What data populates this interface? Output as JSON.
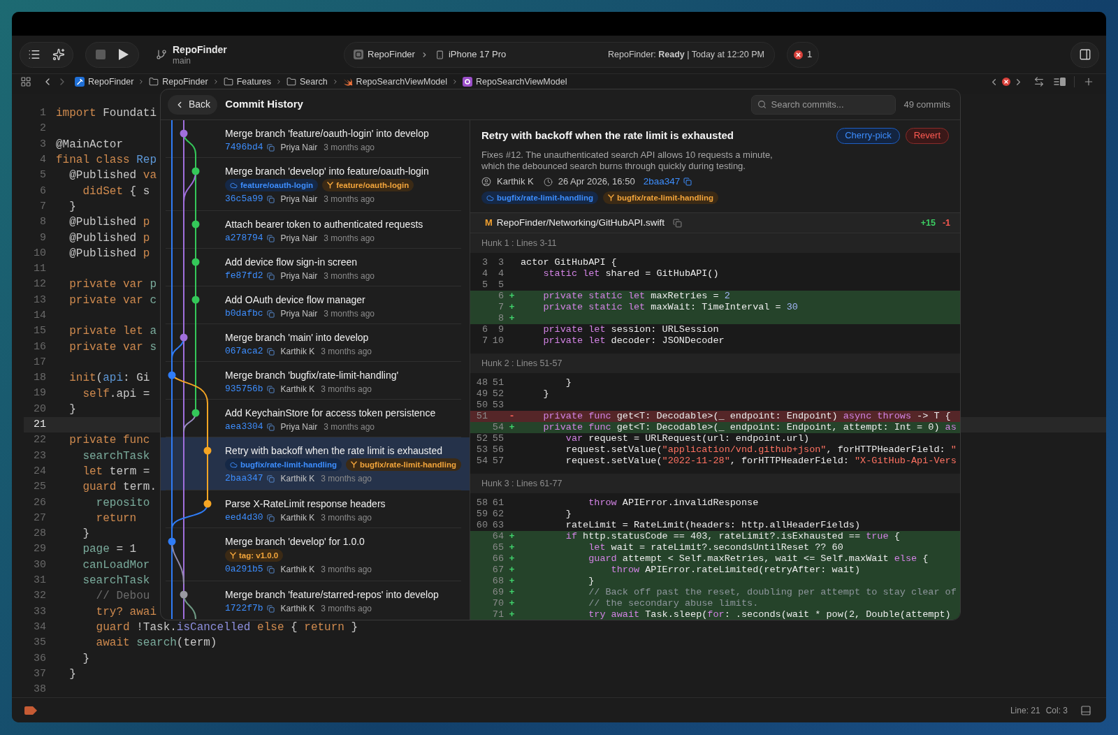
{
  "toolbar": {
    "project": "RepoFinder",
    "branch": "main",
    "scheme": "RepoFinder",
    "device": "iPhone 17 Pro",
    "status": "RepoFinder: **Ready** | Today at 12:20 PM",
    "issues": "1"
  },
  "breadcrumbs": [
    {
      "kind": "project",
      "label": "RepoFinder"
    },
    {
      "kind": "folder",
      "label": "RepoFinder"
    },
    {
      "kind": "folder",
      "label": "Features"
    },
    {
      "kind": "folder",
      "label": "Search"
    },
    {
      "kind": "swift",
      "label": "RepoSearchViewModel"
    },
    {
      "kind": "class",
      "label": "RepoSearchViewModel"
    }
  ],
  "editor": {
    "lines": [
      {
        "number": "1",
        "current": false,
        "tokens": [
          {
            "kind": "keyword",
            "text": "import"
          },
          {
            "kind": "plain",
            "text": " Foundati"
          }
        ]
      },
      {
        "number": "2",
        "current": false
      },
      {
        "number": "3",
        "current": false,
        "tokens": [
          {
            "kind": "plain",
            "text": "@MainActor"
          }
        ]
      },
      {
        "number": "4",
        "current": false,
        "tokens": [
          {
            "kind": "keyword",
            "text": "final class"
          },
          {
            "kind": "type",
            "text": " Rep"
          }
        ]
      },
      {
        "number": "5",
        "current": false,
        "tokens": [
          {
            "kind": "plain",
            "text": "  @Published"
          },
          {
            "kind": "keyword",
            "text": " va"
          }
        ]
      },
      {
        "number": "6",
        "current": false,
        "tokens": [
          {
            "kind": "keyword",
            "text": "    didSet"
          },
          {
            "kind": "plain",
            "text": " { s"
          }
        ]
      },
      {
        "number": "7",
        "current": false,
        "tokens": [
          {
            "kind": "plain",
            "text": "  }"
          }
        ]
      },
      {
        "number": "8",
        "current": false,
        "tokens": [
          {
            "kind": "plain",
            "text": "  @Published"
          },
          {
            "kind": "keyword",
            "text": " p"
          }
        ]
      },
      {
        "number": "9",
        "current": false,
        "tokens": [
          {
            "kind": "plain",
            "text": "  @Published"
          },
          {
            "kind": "keyword",
            "text": " p"
          }
        ]
      },
      {
        "number": "10",
        "current": false,
        "tokens": [
          {
            "kind": "plain",
            "text": "  @Published"
          },
          {
            "kind": "keyword",
            "text": " p"
          }
        ]
      },
      {
        "number": "11",
        "current": false
      },
      {
        "number": "12",
        "current": false,
        "tokens": [
          {
            "kind": "keyword",
            "text": "  private var"
          },
          {
            "kind": "identifier",
            "text": " p"
          }
        ]
      },
      {
        "number": "13",
        "current": false,
        "tokens": [
          {
            "kind": "keyword",
            "text": "  private var"
          },
          {
            "kind": "identifier",
            "text": " c"
          }
        ]
      },
      {
        "number": "14",
        "current": false
      },
      {
        "number": "15",
        "current": false,
        "tokens": [
          {
            "kind": "keyword",
            "text": "  private let"
          },
          {
            "kind": "identifier",
            "text": " a"
          }
        ]
      },
      {
        "number": "16",
        "current": false,
        "tokens": [
          {
            "kind": "keyword",
            "text": "  private var"
          },
          {
            "kind": "identifier",
            "text": " s"
          }
        ]
      },
      {
        "number": "17",
        "current": false
      },
      {
        "number": "18",
        "current": false,
        "tokens": [
          {
            "kind": "keyword",
            "text": "  init"
          },
          {
            "kind": "plain",
            "text": "("
          },
          {
            "kind": "type",
            "text": "api"
          },
          {
            "kind": "plain",
            "text": ": Gi"
          }
        ]
      },
      {
        "number": "19",
        "current": false,
        "tokens": [
          {
            "kind": "keyword",
            "text": "    self"
          },
          {
            "kind": "plain",
            "text": ".api ="
          }
        ]
      },
      {
        "number": "20",
        "current": false,
        "tokens": [
          {
            "kind": "plain",
            "text": "  }"
          }
        ]
      },
      {
        "number": "21",
        "current": true
      },
      {
        "number": "22",
        "current": false,
        "tokens": [
          {
            "kind": "keyword",
            "text": "  private func"
          }
        ]
      },
      {
        "number": "23",
        "current": false,
        "tokens": [
          {
            "kind": "identifier",
            "text": "    searchTask"
          }
        ]
      },
      {
        "number": "24",
        "current": false,
        "tokens": [
          {
            "kind": "keyword",
            "text": "    let"
          },
          {
            "kind": "plain",
            "text": " term ="
          }
        ]
      },
      {
        "number": "25",
        "current": false,
        "tokens": [
          {
            "kind": "keyword",
            "text": "    guard"
          },
          {
            "kind": "plain",
            "text": " term."
          }
        ]
      },
      {
        "number": "26",
        "current": false,
        "tokens": [
          {
            "kind": "identifier",
            "text": "      reposito"
          }
        ]
      },
      {
        "number": "27",
        "current": false,
        "tokens": [
          {
            "kind": "keyword",
            "text": "      return"
          }
        ]
      },
      {
        "number": "28",
        "current": false,
        "tokens": [
          {
            "kind": "plain",
            "text": "    }"
          }
        ]
      },
      {
        "number": "29",
        "current": false,
        "tokens": [
          {
            "kind": "identifier",
            "text": "    page"
          },
          {
            "kind": "plain",
            "text": " = 1"
          }
        ]
      },
      {
        "number": "30",
        "current": false,
        "tokens": [
          {
            "kind": "identifier",
            "text": "    canLoadMor"
          }
        ]
      },
      {
        "number": "31",
        "current": false,
        "tokens": [
          {
            "kind": "identifier",
            "text": "    searchTask"
          }
        ]
      },
      {
        "number": "32",
        "current": false,
        "tokens": [
          {
            "kind": "comment",
            "text": "      // Debou"
          }
        ]
      },
      {
        "number": "33",
        "current": false,
        "tokens": [
          {
            "kind": "keyword",
            "text": "      try? awai"
          }
        ]
      },
      {
        "number": "34",
        "current": false,
        "tokens": [
          {
            "kind": "keyword",
            "text": "      guard"
          },
          {
            "kind": "plain",
            "text": " !Task."
          },
          {
            "kind": "method",
            "text": "isCancelled"
          },
          {
            "kind": "keyword",
            "text": " else"
          },
          {
            "kind": "plain",
            "text": " {"
          },
          {
            "kind": "keyword",
            "text": " return"
          },
          {
            "kind": "plain",
            "text": " }"
          }
        ]
      },
      {
        "number": "35",
        "current": false,
        "tokens": [
          {
            "kind": "keyword",
            "text": "      await"
          },
          {
            "kind": "identifier",
            "text": " search"
          },
          {
            "kind": "plain",
            "text": "(term)"
          }
        ]
      },
      {
        "number": "36",
        "current": false,
        "tokens": [
          {
            "kind": "plain",
            "text": "    }"
          }
        ]
      },
      {
        "number": "37",
        "current": false,
        "tokens": [
          {
            "kind": "plain",
            "text": "  }"
          }
        ]
      },
      {
        "number": "38",
        "current": false
      }
    ]
  },
  "commit_history": {
    "back": "Back",
    "title": "Commit History",
    "search": {
      "placeholder": "Search commits..."
    },
    "count": "49 commits",
    "commits": [
      {
        "title": "Merge branch 'feature/oauth-login' into develop",
        "hash": "7496bd4",
        "author": "Priya Nair",
        "time": "3 months ago",
        "color": "#a06fdc",
        "selected": false
      },
      {
        "title": "Merge branch 'develop' into feature/oauth-login",
        "hash": "36c5a99",
        "author": "Priya Nair",
        "time": "3 months ago",
        "color": "#34c759",
        "selected": false,
        "refs": [
          {
            "kind": "remote",
            "label": "feature/oauth-login"
          },
          {
            "kind": "branch",
            "label": "feature/oauth-login"
          }
        ]
      },
      {
        "title": "Attach bearer token to authenticated requests",
        "hash": "a278794",
        "author": "Priya Nair",
        "time": "3 months ago",
        "color": "#34c759",
        "selected": false
      },
      {
        "title": "Add device flow sign-in screen",
        "hash": "fe87fd2",
        "author": "Priya Nair",
        "time": "3 months ago",
        "color": "#34c759",
        "selected": false
      },
      {
        "title": "Add OAuth device flow manager",
        "hash": "b0dafbc",
        "author": "Priya Nair",
        "time": "3 months ago",
        "color": "#34c759",
        "selected": false
      },
      {
        "title": "Merge branch 'main' into develop",
        "hash": "067aca2",
        "author": "Karthik K",
        "time": "3 months ago",
        "color": "#a06fdc",
        "selected": false
      },
      {
        "title": "Merge branch 'bugfix/rate-limit-handling'",
        "hash": "935756b",
        "author": "Karthik K",
        "time": "3 months ago",
        "color": "#2f7cf6",
        "selected": false
      },
      {
        "title": "Add KeychainStore for access token persistence",
        "hash": "aea3304",
        "author": "Priya Nair",
        "time": "3 months ago",
        "color": "#34c759",
        "selected": false
      },
      {
        "title": "Retry with backoff when the rate limit is exhausted",
        "hash": "2baa347",
        "author": "Karthik K",
        "time": "3 months ago",
        "color": "#f5a524",
        "selected": true,
        "refs": [
          {
            "kind": "remote",
            "label": "bugfix/rate-limit-handling"
          },
          {
            "kind": "branch",
            "label": "bugfix/rate-limit-handling"
          }
        ]
      },
      {
        "title": "Parse X-RateLimit response headers",
        "hash": "eed4d30",
        "author": "Karthik K",
        "time": "3 months ago",
        "color": "#f5a524",
        "selected": false
      },
      {
        "title": "Merge branch 'develop' for 1.0.0",
        "hash": "0a291b5",
        "author": "Karthik K",
        "time": "3 months ago",
        "color": "#2f7cf6",
        "selected": false,
        "refs": [
          {
            "kind": "tag",
            "label": "tag: v1.0.0"
          }
        ]
      },
      {
        "title": "Merge branch 'feature/starred-repos' into develop",
        "hash": "1722f7b",
        "author": "Karthik K",
        "time": "3 months ago",
        "color": "#9a9aa2",
        "selected": false
      }
    ],
    "detail": {
      "title": "Retry with backoff when the rate limit is exhausted",
      "actions": [
        {
          "kind": "primary",
          "label": "Cherry-pick"
        },
        {
          "kind": "destructive",
          "label": "Revert"
        }
      ],
      "description": "Fixes #12. The unauthenticated search API allows 10 requests a minute, which the debounced search burns through quickly during testing.",
      "author": "Karthik K",
      "date": "26 Apr 2026, 16:50",
      "hash": "2baa347",
      "refs": [
        {
          "kind": "remote",
          "label": "bugfix/rate-limit-handling"
        },
        {
          "kind": "branch",
          "label": "bugfix/rate-limit-handling"
        }
      ],
      "file": {
        "status": "M",
        "path": "RepoFinder/Networking/GitHubAPI.swift",
        "additions": "+15",
        "deletions": "-1"
      },
      "hunks": [
        {
          "header": "Hunk 1 : Lines 3-11",
          "lines": [
            {
              "kind": "context",
              "old": "3",
              "new": "3",
              "tokens": [
                {
                  "kind": "plain",
                  "text": "actor GitHubAPI {"
                }
              ]
            },
            {
              "kind": "context",
              "old": "4",
              "new": "4",
              "tokens": [
                {
                  "kind": "keyword",
                  "text": "    static let"
                },
                {
                  "kind": "plain",
                  "text": " shared = GitHubAPI()"
                }
              ]
            },
            {
              "kind": "context",
              "old": "5",
              "new": "5"
            },
            {
              "kind": "added",
              "new": "6",
              "sign": "+",
              "tokens": [
                {
                  "kind": "keyword",
                  "text": "    private static let"
                },
                {
                  "kind": "plain",
                  "text": " maxRetries = "
                },
                {
                  "kind": "number",
                  "text": "2"
                }
              ]
            },
            {
              "kind": "added",
              "new": "7",
              "sign": "+",
              "tokens": [
                {
                  "kind": "keyword",
                  "text": "    private static let"
                },
                {
                  "kind": "plain",
                  "text": " maxWait: TimeInterval = "
                },
                {
                  "kind": "number",
                  "text": "30"
                }
              ]
            },
            {
              "kind": "added",
              "new": "8",
              "sign": "+"
            },
            {
              "kind": "context",
              "old": "6",
              "new": "9",
              "tokens": [
                {
                  "kind": "keyword",
                  "text": "    private let"
                },
                {
                  "kind": "plain",
                  "text": " session: URLSession"
                }
              ]
            },
            {
              "kind": "context",
              "old": "7",
              "new": "10",
              "tokens": [
                {
                  "kind": "keyword",
                  "text": "    private let"
                },
                {
                  "kind": "plain",
                  "text": " decoder: JSONDecoder"
                }
              ]
            }
          ]
        },
        {
          "header": "Hunk 2 : Lines 51-57",
          "lines": [
            {
              "kind": "context",
              "old": "48",
              "new": "51",
              "tokens": [
                {
                  "kind": "plain",
                  "text": "        }"
                }
              ]
            },
            {
              "kind": "context",
              "old": "49",
              "new": "52",
              "tokens": [
                {
                  "kind": "plain",
                  "text": "    }"
                }
              ]
            },
            {
              "kind": "context",
              "old": "50",
              "new": "53"
            },
            {
              "kind": "removed",
              "old": "51",
              "sign": "-",
              "tokens": [
                {
                  "kind": "keyword",
                  "text": "    private func"
                },
                {
                  "kind": "plain",
                  "text": " get<T: Decodable>(_ endpoint: Endpoint) "
                },
                {
                  "kind": "keyword",
                  "text": "async throws"
                },
                {
                  "kind": "plain",
                  "text": " -> T {"
                }
              ]
            },
            {
              "kind": "added",
              "new": "54",
              "sign": "+",
              "tokens": [
                {
                  "kind": "keyword",
                  "text": "    private func"
                },
                {
                  "kind": "plain",
                  "text": " get<T: Decodable>(_ endpoint: Endpoint, attempt: Int = 0) "
                },
                {
                  "kind": "keyword",
                  "text": "as"
                }
              ]
            },
            {
              "kind": "context",
              "old": "52",
              "new": "55",
              "tokens": [
                {
                  "kind": "keyword",
                  "text": "        var"
                },
                {
                  "kind": "plain",
                  "text": " request = URLRequest(url: endpoint.url)"
                }
              ]
            },
            {
              "kind": "context",
              "old": "53",
              "new": "56",
              "tokens": [
                {
                  "kind": "plain",
                  "text": "        request.setValue("
                },
                {
                  "kind": "string",
                  "text": "\"application/vnd.github+json\""
                },
                {
                  "kind": "plain",
                  "text": ", forHTTPHeaderField: "
                },
                {
                  "kind": "string",
                  "text": "\""
                }
              ]
            },
            {
              "kind": "context",
              "old": "54",
              "new": "57",
              "tokens": [
                {
                  "kind": "plain",
                  "text": "        request.setValue("
                },
                {
                  "kind": "string",
                  "text": "\"2022-11-28\""
                },
                {
                  "kind": "plain",
                  "text": ", forHTTPHeaderField: "
                },
                {
                  "kind": "string",
                  "text": "\"X-GitHub-Api-Vers"
                }
              ]
            }
          ]
        },
        {
          "header": "Hunk 3 : Lines 61-77",
          "lines": [
            {
              "kind": "context",
              "old": "58",
              "new": "61",
              "tokens": [
                {
                  "kind": "keyword",
                  "text": "            throw"
                },
                {
                  "kind": "plain",
                  "text": " APIError.invalidResponse"
                }
              ]
            },
            {
              "kind": "context",
              "old": "59",
              "new": "62",
              "tokens": [
                {
                  "kind": "plain",
                  "text": "        }"
                }
              ]
            },
            {
              "kind": "context",
              "old": "60",
              "new": "63",
              "tokens": [
                {
                  "kind": "plain",
                  "text": "        rateLimit = RateLimit(headers: http.allHeaderFields)"
                }
              ]
            },
            {
              "kind": "added",
              "new": "64",
              "sign": "+",
              "tokens": [
                {
                  "kind": "keyword",
                  "text": "        if"
                },
                {
                  "kind": "plain",
                  "text": " http.statusCode == 403, rateLimit?.isExhausted == "
                },
                {
                  "kind": "keyword",
                  "text": "true"
                },
                {
                  "kind": "plain",
                  "text": " {"
                }
              ]
            },
            {
              "kind": "added",
              "new": "65",
              "sign": "+",
              "tokens": [
                {
                  "kind": "keyword",
                  "text": "            let"
                },
                {
                  "kind": "plain",
                  "text": " wait = rateLimit?.secondsUntilReset ?? 60"
                }
              ]
            },
            {
              "kind": "added",
              "new": "66",
              "sign": "+",
              "tokens": [
                {
                  "kind": "keyword",
                  "text": "            guard"
                },
                {
                  "kind": "plain",
                  "text": " attempt < Self.maxRetries, wait <= Self.maxWait "
                },
                {
                  "kind": "keyword",
                  "text": "else"
                },
                {
                  "kind": "plain",
                  "text": " {"
                }
              ]
            },
            {
              "kind": "added",
              "new": "67",
              "sign": "+",
              "tokens": [
                {
                  "kind": "keyword",
                  "text": "                throw"
                },
                {
                  "kind": "plain",
                  "text": " APIError.rateLimited(retryAfter: wait)"
                }
              ]
            },
            {
              "kind": "added",
              "new": "68",
              "sign": "+",
              "tokens": [
                {
                  "kind": "plain",
                  "text": "            }"
                }
              ]
            },
            {
              "kind": "added",
              "new": "69",
              "sign": "+",
              "tokens": [
                {
                  "kind": "comment",
                  "text": "            // Back off past the reset, doubling per attempt to stay clear of"
                }
              ]
            },
            {
              "kind": "added",
              "new": "70",
              "sign": "+",
              "tokens": [
                {
                  "kind": "comment",
                  "text": "            // the secondary abuse limits."
                }
              ]
            },
            {
              "kind": "added",
              "new": "71",
              "sign": "+",
              "tokens": [
                {
                  "kind": "keyword",
                  "text": "            try await"
                },
                {
                  "kind": "plain",
                  "text": " Task.sleep("
                },
                {
                  "kind": "keyword",
                  "text": "for"
                },
                {
                  "kind": "plain",
                  "text": ": .seconds(wait * pow(2, Double(attempt)"
                }
              ]
            }
          ]
        }
      ]
    }
  },
  "status_bar": {
    "line": "Line: 21",
    "column": "Col: 3"
  }
}
